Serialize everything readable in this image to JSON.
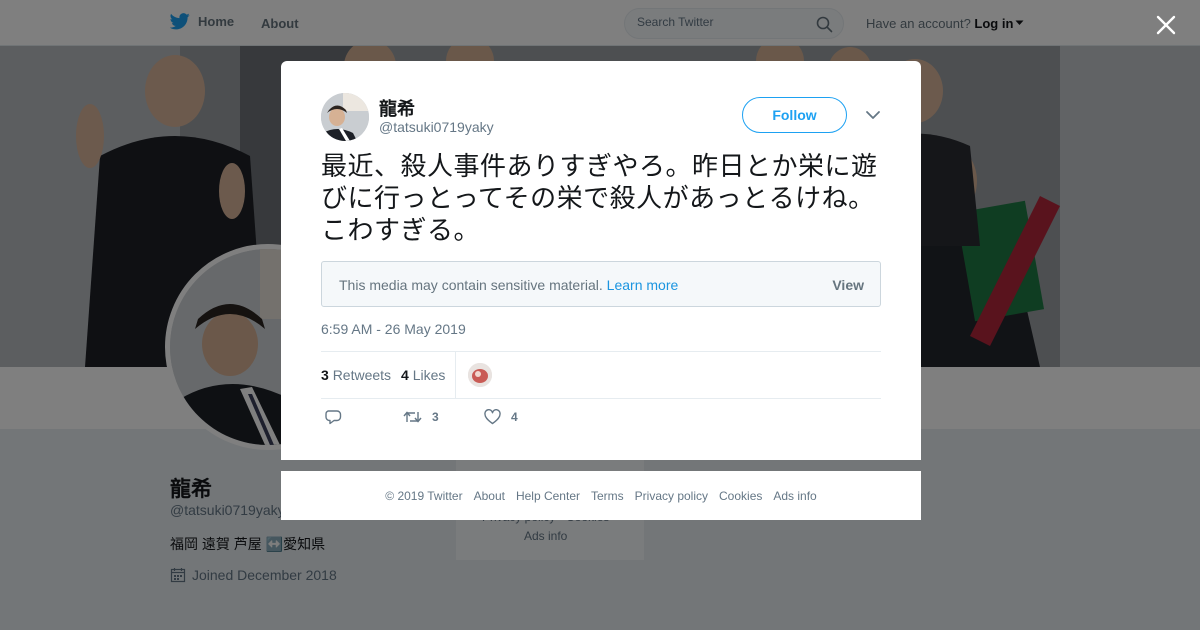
{
  "nav": {
    "home_label": "Home",
    "about_label": "About",
    "search_placeholder": "Search Twitter",
    "account_prompt": "Have an account?",
    "login_label": "Log in"
  },
  "profile": {
    "name": "龍希",
    "handle": "@tatsuki0719yaky",
    "bio": "福岡 遠賀 芦屋 ↔️愛知県",
    "joined": "Joined December 2018",
    "sidebar_privacy": "Privacy policy · Cookies",
    "sidebar_ads": "Ads info"
  },
  "tweet": {
    "author_name": "龍希",
    "author_handle": "@tatsuki0719yaky",
    "follow_label": "Follow",
    "text": "最近、殺人事件ありすぎやろ。昨日とか栄に遊びに行っとってその栄で殺人があっとるけね。こわすぎる。",
    "sensitive_notice": "This media may contain sensitive material.",
    "learn_more_label": "Learn more",
    "view_label": "View",
    "timestamp": "6:59 AM - 26 May 2019",
    "retweets_count": "3",
    "retweets_label": "Retweets",
    "likes_count": "4",
    "likes_label": "Likes",
    "action_retweet_count": "3",
    "action_like_count": "4"
  },
  "footer": {
    "copyright": "© 2019 Twitter",
    "links": [
      "About",
      "Help Center",
      "Terms",
      "Privacy policy",
      "Cookies",
      "Ads info"
    ]
  },
  "colors": {
    "accent": "#1da1f2",
    "link": "#1b95e0",
    "muted_text": "#657786",
    "overlay": "rgba(0,0,0,0.5)"
  },
  "icons": [
    "twitter-bird-icon",
    "search-icon",
    "caret-down-icon",
    "close-icon",
    "calendar-icon",
    "reply-icon",
    "retweet-icon",
    "heart-icon"
  ]
}
